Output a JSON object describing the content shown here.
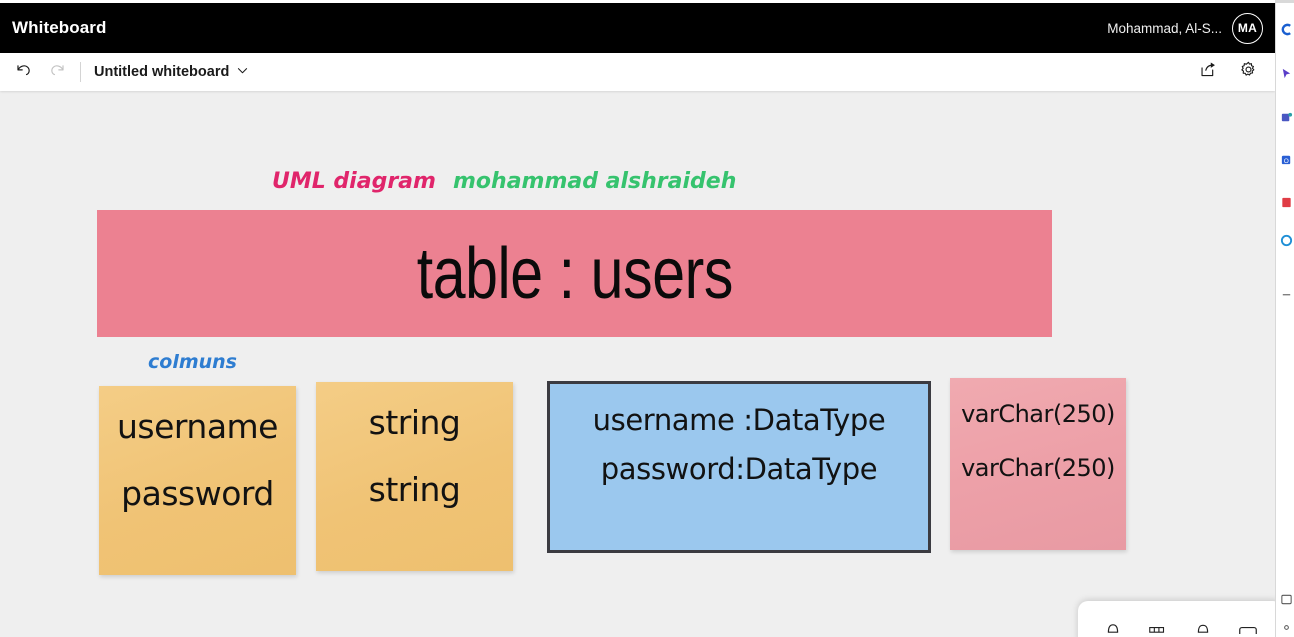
{
  "window": {
    "app_title": "Whiteboard",
    "user_name": "Mohammad, Al-S...",
    "avatar_initials": "MA"
  },
  "commandbar": {
    "undo_label": "Undo",
    "redo_label": "Redo",
    "document_title": "Untitled whiteboard",
    "chevron": "∨",
    "share_label": "Share",
    "settings_label": "Settings"
  },
  "icons": {
    "undo": "undo-arrow-icon",
    "redo": "redo-arrow-icon",
    "chevron_down": "chevron-down-icon",
    "share": "share-icon",
    "gear": "gear-icon"
  },
  "canvas": {
    "annotations": [
      {
        "text": "UML diagram",
        "color": "#e0256b"
      },
      {
        "text": "mohammad alshraideh",
        "color": "#36c36e"
      },
      {
        "text": "colmuns",
        "color": "#2e7dd1"
      }
    ],
    "title_block": {
      "text": "table : users",
      "fill": "#ec8191"
    },
    "notes": [
      {
        "name": "column-names",
        "fill": "#f0c375",
        "lines": [
          "username",
          "password"
        ]
      },
      {
        "name": "column-types",
        "fill": "#f0c375",
        "lines": [
          "string",
          "string"
        ]
      },
      {
        "name": "datatype-lengths",
        "fill": "#eda0a8",
        "lines": [
          "varChar(250)",
          "varChar(250)"
        ]
      }
    ],
    "datatype_box": {
      "fill": "#9bc8ee",
      "border": "#3b3b41",
      "lines": [
        "username :DataType",
        "password:DataType"
      ]
    }
  },
  "bottom_toolbar": {
    "tools": [
      {
        "name": "pen-tool",
        "label": "Pen"
      },
      {
        "name": "highlighter-tool",
        "label": "Highlighter"
      },
      {
        "name": "eraser-tool",
        "label": "Eraser"
      },
      {
        "name": "note-tool",
        "label": "Note"
      }
    ]
  },
  "edge_strip": {
    "items": [
      {
        "name": "copilot-icon",
        "color": "#1a5fd0"
      },
      {
        "name": "cursor-icon",
        "color": "#5a3ec8"
      },
      {
        "name": "teams-icon",
        "color": "#4a57c2"
      },
      {
        "name": "outlook-icon",
        "color": "#2a5fd4"
      },
      {
        "name": "pdf-icon",
        "color": "#e03c45"
      },
      {
        "name": "game-icon",
        "color": "#1f8fd6"
      }
    ]
  }
}
